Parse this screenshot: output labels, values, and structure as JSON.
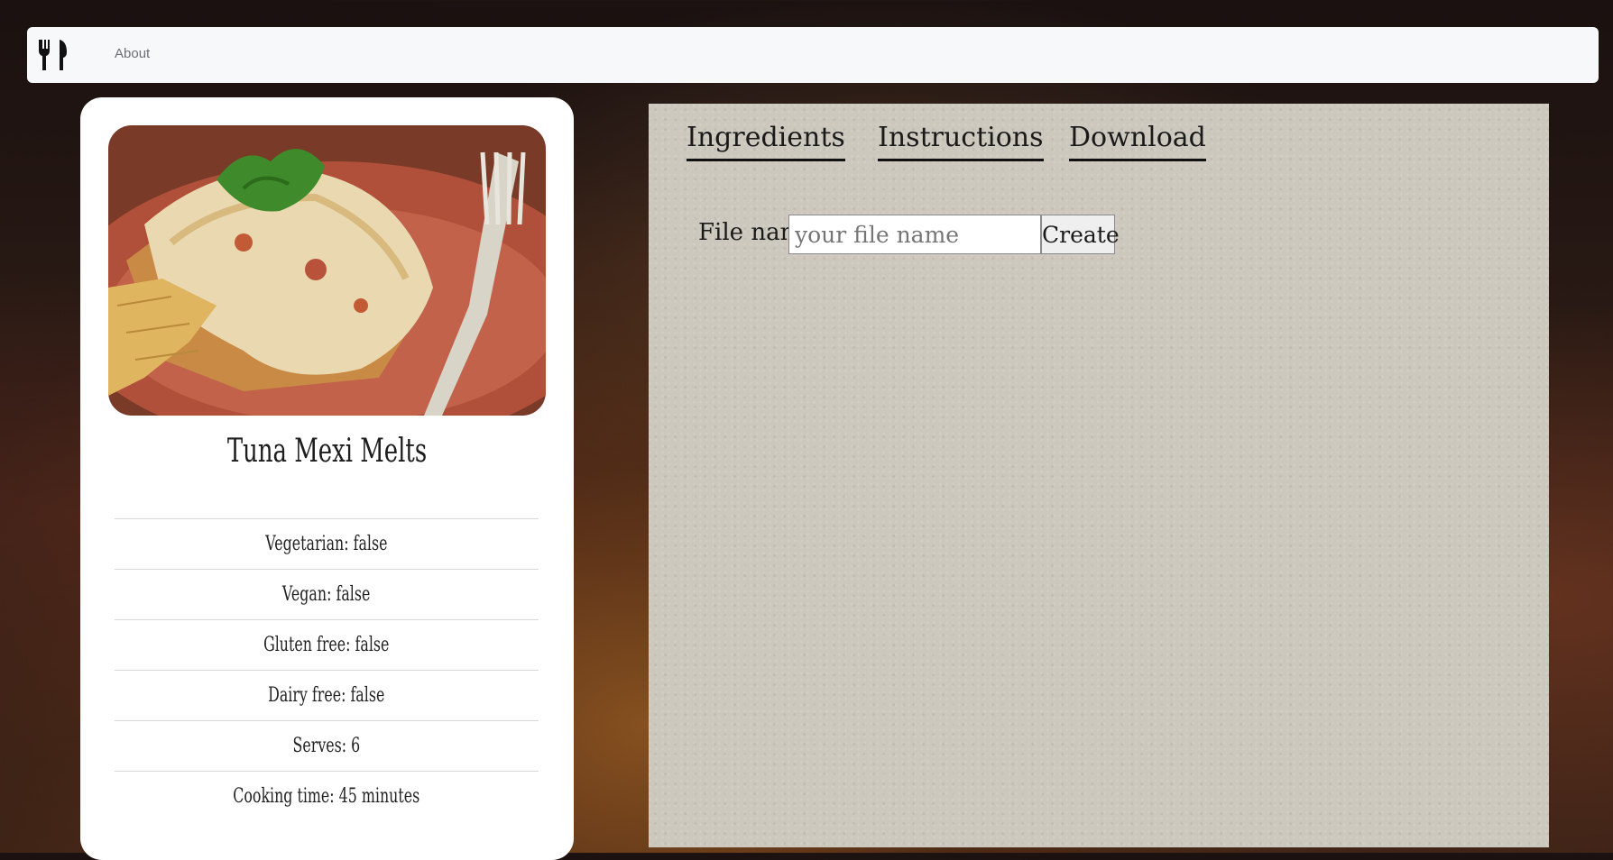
{
  "navbar": {
    "about_label": "About",
    "brand_icon": "fork-knife-icon"
  },
  "recipe": {
    "title": "Tuna Mexi Melts",
    "facts": [
      "Vegetarian: false",
      "Vegan: false",
      "Gluten free: false",
      "Dairy free: false",
      "Serves: 6",
      "Cooking time: 45 minutes"
    ]
  },
  "tabs": [
    "Ingredients",
    "Instructions",
    "Download"
  ],
  "download": {
    "file_label": "File name:",
    "file_placeholder": "your file name",
    "create_label": "Create"
  }
}
